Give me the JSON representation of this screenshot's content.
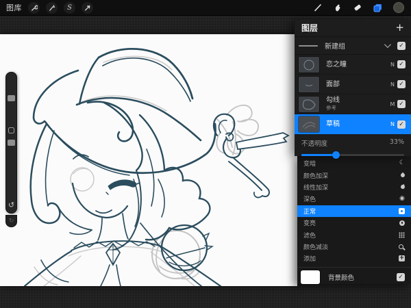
{
  "colors": {
    "accent_blue": "#0f82ff",
    "line_art": "#2b4d5e",
    "sketch_gray": "#c6c6c6",
    "canvas": "#fbfbfb",
    "background_swatch": "#ffffff"
  },
  "topbar": {
    "gallery_label": "图库",
    "left_icons": [
      "wrench-icon",
      "adjustments-wand-icon",
      "selection-s-icon",
      "transform-arrow-icon"
    ],
    "right_icons": [
      "brush-icon",
      "smudge-finger-icon",
      "eraser-icon",
      "layers-icon-active",
      "color-swatch-circle"
    ]
  },
  "sidebar": {
    "items": [
      "brush-size-slider",
      "modify-button",
      "brush-opacity-slider",
      "undo-button",
      "redo-button"
    ],
    "undo_glyph": "↺",
    "redo_glyph": "↻"
  },
  "panel": {
    "title": "图层",
    "add_label": "+",
    "group": {
      "label": "新建组"
    },
    "layers": [
      {
        "name": "恋之瞳",
        "blend": "N"
      },
      {
        "name": "面部",
        "blend": "N"
      },
      {
        "name": "勾线",
        "subtitle": "参考",
        "blend": "M"
      },
      {
        "name": "草稿",
        "blend": "N",
        "selected": true
      }
    ],
    "check_glyph": "✓",
    "opacity": {
      "label": "不透明度",
      "value": "33%",
      "percent": 33
    }
  },
  "blend_menu": {
    "items": [
      {
        "label": "变暗",
        "icon": "darken-moon-icon",
        "glyph": "☾"
      },
      {
        "label": "颜色加深",
        "icon": "color-burn-drop-icon"
      },
      {
        "label": "线性加深",
        "icon": "linear-burn-drop-icon"
      },
      {
        "label": "深色",
        "icon": "darker-color-icon",
        "glyph": "◉"
      },
      {
        "label": "正常",
        "icon": "normal-square-icon",
        "selected": true
      },
      {
        "label": "变亮",
        "icon": "lighten-circle-icon"
      },
      {
        "label": "滤色",
        "icon": "screen-grid-icon"
      },
      {
        "label": "颜色减淡",
        "icon": "color-dodge-icon"
      },
      {
        "label": "添加",
        "icon": "add-plus-icon",
        "glyph": "+"
      }
    ],
    "background_row": {
      "label": "背景颜色"
    }
  }
}
